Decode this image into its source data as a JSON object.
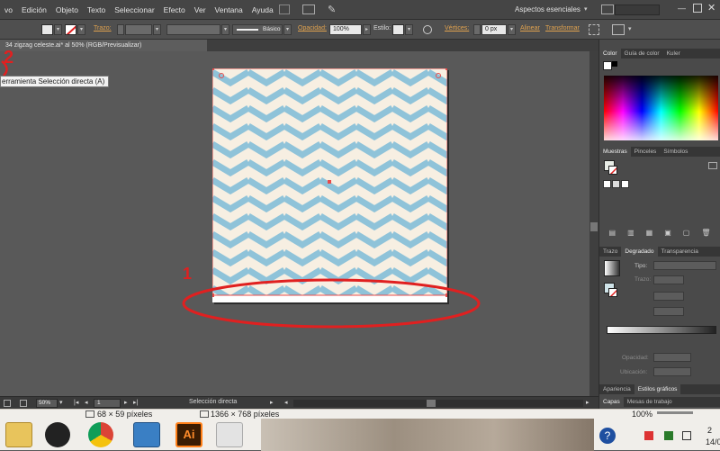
{
  "menubar": {
    "items": [
      "vo",
      "Edición",
      "Objeto",
      "Texto",
      "Seleccionar",
      "Efecto",
      "Ver",
      "Ventana",
      "Ayuda"
    ],
    "workspace": "Aspectos esenciales"
  },
  "controlbar": {
    "stroke_label": "Trazo:",
    "brush_label": "Básico",
    "opacity_label": "Opacidad:",
    "opacity_value": "100%",
    "style_label": "Estilo:",
    "vertices_label": "Vértices:",
    "vertices_value": "0 px",
    "align_label": "Alinear",
    "transform_label": "Transformar"
  },
  "document": {
    "tab_title": "34 zigzag celeste.ai* al 50% (RGB/Previsualizar)"
  },
  "tooltip": "erramienta Selección directa (A)",
  "annotations": {
    "label1": "1",
    "label2": "2"
  },
  "statusbar": {
    "zoom": "50%",
    "page": "1",
    "tool": "Selección directa"
  },
  "panels": {
    "color_tabs": [
      "Color",
      "Guía de color",
      "Kuler"
    ],
    "swatch_tabs": [
      "Muestras",
      "Pinceles",
      "Símbolos"
    ],
    "gradient_tabs": [
      "Trazo",
      "Degradado",
      "Transparencia"
    ],
    "gradient_type_label": "Tipo:",
    "trazo_label": "Trazo:",
    "opacity_label": "Opacidad:",
    "location_label": "Ubicación:",
    "appearance_tabs": [
      "Apariencia",
      "Estilos gráficos"
    ],
    "layer_tabs": [
      "Capas",
      "Mesas de trabajo"
    ]
  },
  "taskbar": {
    "dim1": "68 × 59 píxeles",
    "dim2": "1366 × 768 píxeles",
    "zoom": "100%",
    "ai_label": "Ai",
    "clock_a": "2",
    "clock_b": "14/0"
  },
  "colors": {
    "zigzag_blue": "#8fc3d9",
    "zigzag_cream": "#f7efe2",
    "annotation_red": "#e02020",
    "accent_orange": "#e0a24f"
  }
}
